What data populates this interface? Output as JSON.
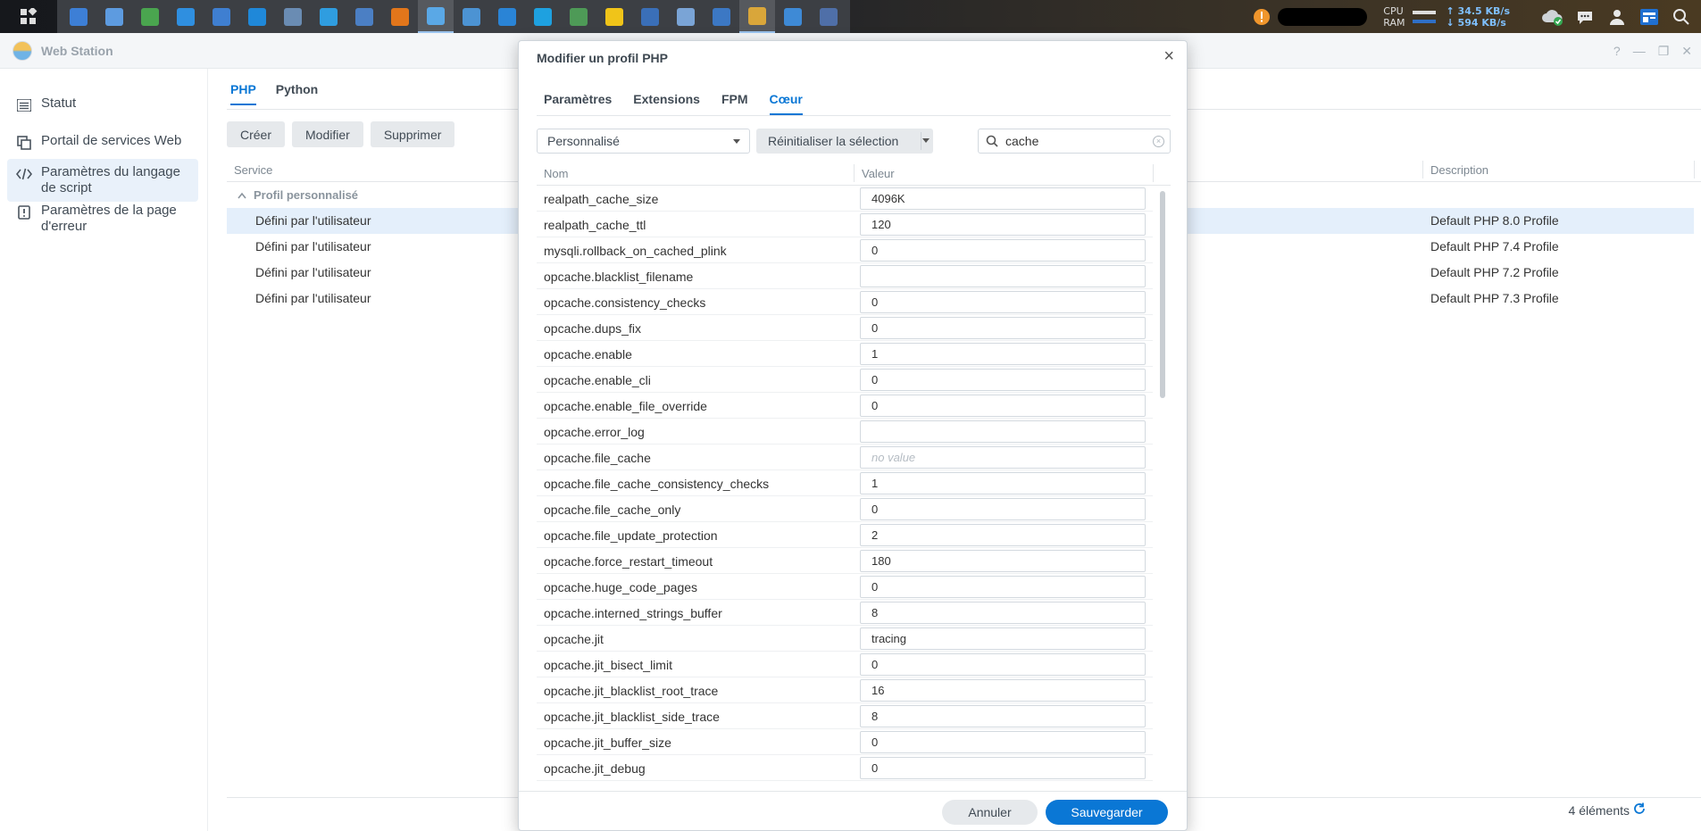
{
  "taskbar": {
    "apps": [
      "app-1",
      "app-2",
      "app-3",
      "app-4",
      "app-5",
      "app-6",
      "app-7",
      "app-8",
      "app-9",
      "app-10",
      "app-11",
      "app-12",
      "app-13",
      "app-14",
      "app-15",
      "app-16",
      "app-17",
      "app-18",
      "app-19",
      "app-20",
      "app-21",
      "app-22"
    ],
    "cpu_label": "CPU",
    "ram_label": "RAM",
    "upload": "↑ 34.5 KB/s",
    "download": "↓ 594 KB/s"
  },
  "window": {
    "app_name": "Web Station",
    "controls": [
      "?",
      "—",
      "❐",
      "✕"
    ]
  },
  "sidebar": {
    "items": [
      {
        "label": "Statut",
        "icon": "list-icon"
      },
      {
        "label": "Portail de services Web",
        "icon": "portal-icon"
      },
      {
        "label": "Paramètres du langage de script",
        "icon": "code-icon"
      },
      {
        "label": "Paramètres de la page d'erreur",
        "icon": "error-page-icon"
      }
    ]
  },
  "main": {
    "tabs": [
      "PHP",
      "Python"
    ],
    "buttons": [
      "Créer",
      "Modifier",
      "Supprimer"
    ],
    "columns": {
      "service": "Service",
      "description": "Description"
    },
    "group": "Profil personnalisé",
    "rows": [
      {
        "service": "Défini par l'utilisateur",
        "description": "Default PHP 8.0 Profile"
      },
      {
        "service": "Défini par l'utilisateur",
        "description": "Default PHP 7.4 Profile"
      },
      {
        "service": "Défini par l'utilisateur",
        "description": "Default PHP 7.2 Profile"
      },
      {
        "service": "Défini par l'utilisateur",
        "description": "Default PHP 7.3 Profile"
      }
    ],
    "count": "4 éléments"
  },
  "dialog": {
    "title": "Modifier un profil PHP",
    "tabs": [
      "Paramètres",
      "Extensions",
      "FPM",
      "Cœur"
    ],
    "select_value": "Personnalisé",
    "reset_label": "Réinitialiser la sélection",
    "search_value": "cache",
    "columns": {
      "name": "Nom",
      "value": "Valeur"
    },
    "rows": [
      {
        "name": "realpath_cache_size",
        "value": "4096K"
      },
      {
        "name": "realpath_cache_ttl",
        "value": "120"
      },
      {
        "name": "mysqli.rollback_on_cached_plink",
        "value": "0"
      },
      {
        "name": "opcache.blacklist_filename",
        "value": ""
      },
      {
        "name": "opcache.consistency_checks",
        "value": "0"
      },
      {
        "name": "opcache.dups_fix",
        "value": "0"
      },
      {
        "name": "opcache.enable",
        "value": "1"
      },
      {
        "name": "opcache.enable_cli",
        "value": "0"
      },
      {
        "name": "opcache.enable_file_override",
        "value": "0"
      },
      {
        "name": "opcache.error_log",
        "value": ""
      },
      {
        "name": "opcache.file_cache",
        "value": "",
        "placeholder": "no value"
      },
      {
        "name": "opcache.file_cache_consistency_checks",
        "value": "1"
      },
      {
        "name": "opcache.file_cache_only",
        "value": "0"
      },
      {
        "name": "opcache.file_update_protection",
        "value": "2"
      },
      {
        "name": "opcache.force_restart_timeout",
        "value": "180"
      },
      {
        "name": "opcache.huge_code_pages",
        "value": "0"
      },
      {
        "name": "opcache.interned_strings_buffer",
        "value": "8"
      },
      {
        "name": "opcache.jit",
        "value": "tracing"
      },
      {
        "name": "opcache.jit_bisect_limit",
        "value": "0"
      },
      {
        "name": "opcache.jit_blacklist_root_trace",
        "value": "16"
      },
      {
        "name": "opcache.jit_blacklist_side_trace",
        "value": "8"
      },
      {
        "name": "opcache.jit_buffer_size",
        "value": "0"
      },
      {
        "name": "opcache.jit_debug",
        "value": "0"
      }
    ],
    "cancel_label": "Annuler",
    "save_label": "Sauvegarder"
  },
  "colors": {
    "accent": "#0a77d5",
    "selected_row": "#e4effb"
  }
}
